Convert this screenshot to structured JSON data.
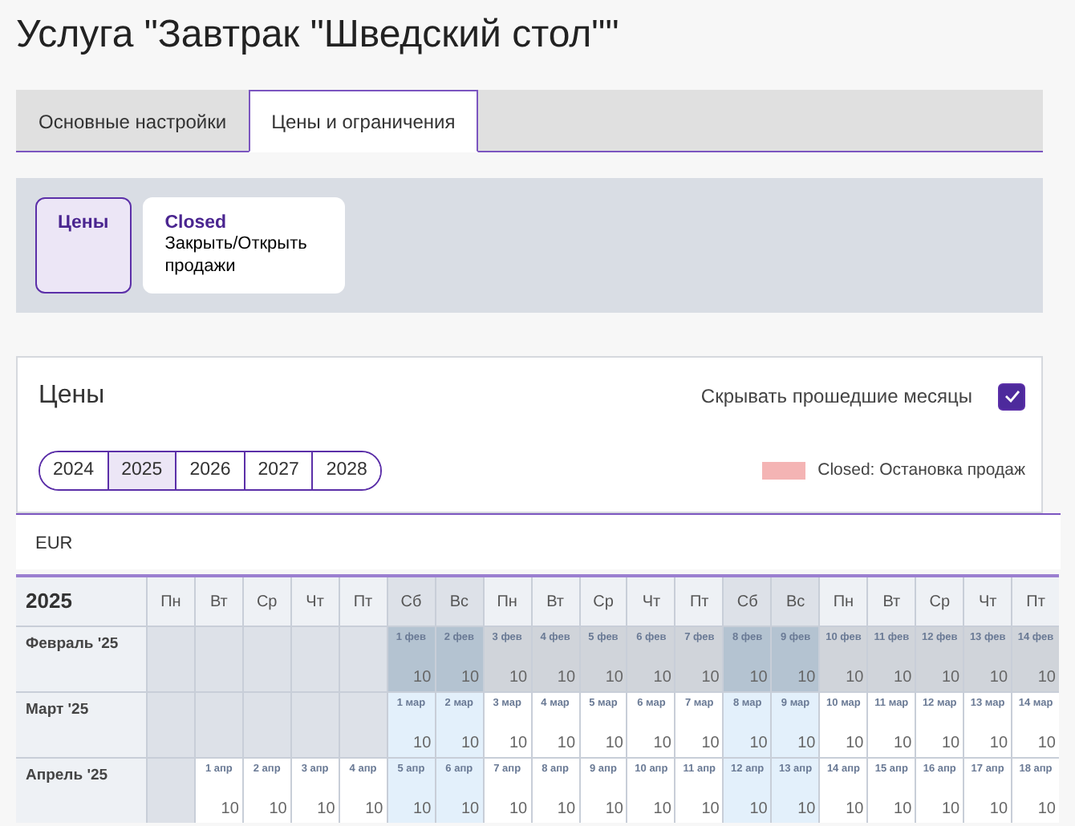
{
  "title": "Услуга \"Завтрак \"Шведский стол\"\"",
  "tabs": [
    {
      "label": "Основные настройки",
      "selected": false
    },
    {
      "label": "Цены и ограничения",
      "selected": true
    }
  ],
  "modes": [
    {
      "title": "Цены",
      "selected": true
    },
    {
      "title": "Closed",
      "subtitle": "Закрыть/Открыть продажи",
      "selected": false
    }
  ],
  "prices_card": {
    "heading": "Цены",
    "hide_past": {
      "label": "Скрывать прошедшие месяцы",
      "checked": true
    },
    "years": [
      {
        "label": "2024",
        "selected": false
      },
      {
        "label": "2025",
        "selected": true
      },
      {
        "label": "2026",
        "selected": false
      },
      {
        "label": "2027",
        "selected": false
      },
      {
        "label": "2028",
        "selected": false
      }
    ],
    "legend": {
      "label": "Closed: Остановка продаж",
      "color": "#f4b4b4"
    }
  },
  "currency": "EUR",
  "calendar": {
    "year": "2025",
    "weekdays": [
      {
        "label": "Пн",
        "weekend": false
      },
      {
        "label": "Вт",
        "weekend": false
      },
      {
        "label": "Ср",
        "weekend": false
      },
      {
        "label": "Чт",
        "weekend": false
      },
      {
        "label": "Пт",
        "weekend": false
      },
      {
        "label": "Сб",
        "weekend": true
      },
      {
        "label": "Вс",
        "weekend": true
      },
      {
        "label": "Пн",
        "weekend": false
      },
      {
        "label": "Вт",
        "weekend": false
      },
      {
        "label": "Ср",
        "weekend": false
      },
      {
        "label": "Чт",
        "weekend": false
      },
      {
        "label": "Пт",
        "weekend": false
      },
      {
        "label": "Сб",
        "weekend": true
      },
      {
        "label": "Вс",
        "weekend": true
      },
      {
        "label": "Пн",
        "weekend": false
      },
      {
        "label": "Вт",
        "weekend": false
      },
      {
        "label": "Ср",
        "weekend": false
      },
      {
        "label": "Чт",
        "weekend": false
      },
      {
        "label": "Пт",
        "weekend": false
      }
    ],
    "months": [
      {
        "label": "Февраль '25",
        "past": true,
        "cells": [
          {
            "kind": "blank"
          },
          {
            "kind": "blank"
          },
          {
            "kind": "blank"
          },
          {
            "kind": "blank"
          },
          {
            "kind": "blank"
          },
          {
            "kind": "day",
            "date": "1 фев",
            "price": "10"
          },
          {
            "kind": "day",
            "date": "2 фев",
            "price": "10"
          },
          {
            "kind": "day",
            "date": "3 фев",
            "price": "10"
          },
          {
            "kind": "day",
            "date": "4 фев",
            "price": "10"
          },
          {
            "kind": "day",
            "date": "5 фев",
            "price": "10"
          },
          {
            "kind": "day",
            "date": "6 фев",
            "price": "10"
          },
          {
            "kind": "day",
            "date": "7 фев",
            "price": "10"
          },
          {
            "kind": "day",
            "date": "8 фев",
            "price": "10"
          },
          {
            "kind": "day",
            "date": "9 фев",
            "price": "10"
          },
          {
            "kind": "day",
            "date": "10 фев",
            "price": "10"
          },
          {
            "kind": "day",
            "date": "11 фев",
            "price": "10"
          },
          {
            "kind": "day",
            "date": "12 фев",
            "price": "10"
          },
          {
            "kind": "day",
            "date": "13 фев",
            "price": "10"
          },
          {
            "kind": "day",
            "date": "14 фев",
            "price": "10"
          }
        ]
      },
      {
        "label": "Март '25",
        "past": false,
        "cells": [
          {
            "kind": "blank"
          },
          {
            "kind": "blank"
          },
          {
            "kind": "blank"
          },
          {
            "kind": "blank"
          },
          {
            "kind": "blank"
          },
          {
            "kind": "day",
            "date": "1 мар",
            "price": "10"
          },
          {
            "kind": "day",
            "date": "2 мар",
            "price": "10"
          },
          {
            "kind": "day",
            "date": "3 мар",
            "price": "10"
          },
          {
            "kind": "day",
            "date": "4 мар",
            "price": "10"
          },
          {
            "kind": "day",
            "date": "5 мар",
            "price": "10"
          },
          {
            "kind": "day",
            "date": "6 мар",
            "price": "10"
          },
          {
            "kind": "day",
            "date": "7 мар",
            "price": "10"
          },
          {
            "kind": "day",
            "date": "8 мар",
            "price": "10"
          },
          {
            "kind": "day",
            "date": "9 мар",
            "price": "10"
          },
          {
            "kind": "day",
            "date": "10 мар",
            "price": "10"
          },
          {
            "kind": "day",
            "date": "11 мар",
            "price": "10"
          },
          {
            "kind": "day",
            "date": "12 мар",
            "price": "10"
          },
          {
            "kind": "day",
            "date": "13 мар",
            "price": "10"
          },
          {
            "kind": "day",
            "date": "14 мар",
            "price": "10"
          }
        ]
      },
      {
        "label": "Апрель '25",
        "past": false,
        "cells": [
          {
            "kind": "blank"
          },
          {
            "kind": "day",
            "date": "1 апр",
            "price": "10"
          },
          {
            "kind": "day",
            "date": "2 апр",
            "price": "10"
          },
          {
            "kind": "day",
            "date": "3 апр",
            "price": "10"
          },
          {
            "kind": "day",
            "date": "4 апр",
            "price": "10"
          },
          {
            "kind": "day",
            "date": "5 апр",
            "price": "10"
          },
          {
            "kind": "day",
            "date": "6 апр",
            "price": "10"
          },
          {
            "kind": "day",
            "date": "7 апр",
            "price": "10"
          },
          {
            "kind": "day",
            "date": "8 апр",
            "price": "10"
          },
          {
            "kind": "day",
            "date": "9 апр",
            "price": "10"
          },
          {
            "kind": "day",
            "date": "10 апр",
            "price": "10"
          },
          {
            "kind": "day",
            "date": "11 апр",
            "price": "10"
          },
          {
            "kind": "day",
            "date": "12 апр",
            "price": "10"
          },
          {
            "kind": "day",
            "date": "13 апр",
            "price": "10"
          },
          {
            "kind": "day",
            "date": "14 апр",
            "price": "10"
          },
          {
            "kind": "day",
            "date": "15 апр",
            "price": "10"
          },
          {
            "kind": "day",
            "date": "16 апр",
            "price": "10"
          },
          {
            "kind": "day",
            "date": "17 апр",
            "price": "10"
          },
          {
            "kind": "day",
            "date": "18 апр",
            "price": "10"
          }
        ]
      }
    ]
  }
}
